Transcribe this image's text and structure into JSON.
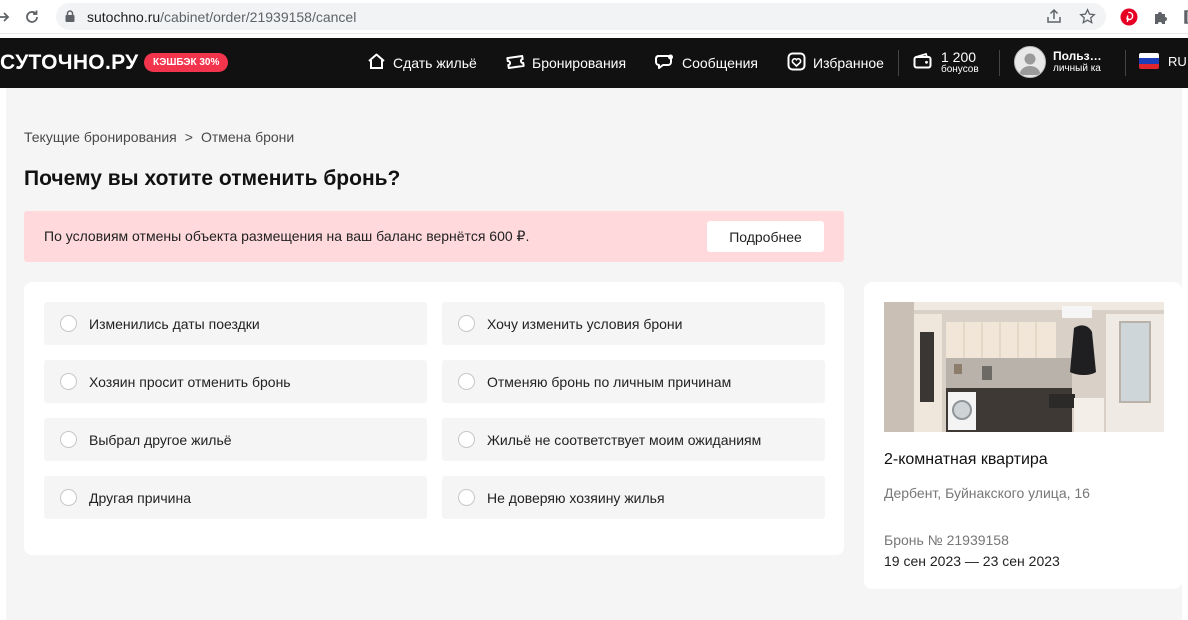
{
  "browser": {
    "url_host": "sutochno.ru",
    "url_path": "/cabinet/order/21939158/cancel"
  },
  "header": {
    "logo": "СУТОЧНО.РУ",
    "cashback_badge": "КЭШБЭК 30%",
    "nav": [
      {
        "label": "Сдать жильё",
        "icon": "house-icon"
      },
      {
        "label": "Бронирования",
        "icon": "ticket-icon"
      },
      {
        "label": "Сообщения",
        "icon": "chat-icon"
      },
      {
        "label": "Избранное",
        "icon": "heart-icon"
      }
    ],
    "bonus_amount": "1 200",
    "bonus_label": "бонусов",
    "user_name": "Польз…",
    "user_sub": "личный ка",
    "lang": "RU"
  },
  "breadcrumb": {
    "items": [
      "Текущие бронирования",
      "Отмена брони"
    ],
    "separator": ">"
  },
  "page_title": "Почему вы хотите отменить бронь?",
  "alert": {
    "text": "По условиям отмены объекта размещения на ваш баланс вернётся 600 ₽.",
    "button": "Подробнее"
  },
  "reasons": [
    "Изменились даты поездки",
    "Хочу изменить условия брони",
    "Хозяин просит отменить бронь",
    "Отменяю бронь по личным причинам",
    "Выбрал другое жильё",
    "Жильё не соответствует моим ожиданиям",
    "Другая причина",
    "Не доверяю хозяину жилья"
  ],
  "booking": {
    "title": "2-комнатная квартира",
    "address": "Дербент, Буйнакского улица, 16",
    "number": "Бронь № 21939158",
    "dates": "19 сен 2023 — 23 сен 2023"
  },
  "colors": {
    "header_bg": "#111111",
    "accent_red": "#f2344d",
    "alert_bg": "#ffd9dc",
    "page_bg": "#f5f5f5"
  }
}
